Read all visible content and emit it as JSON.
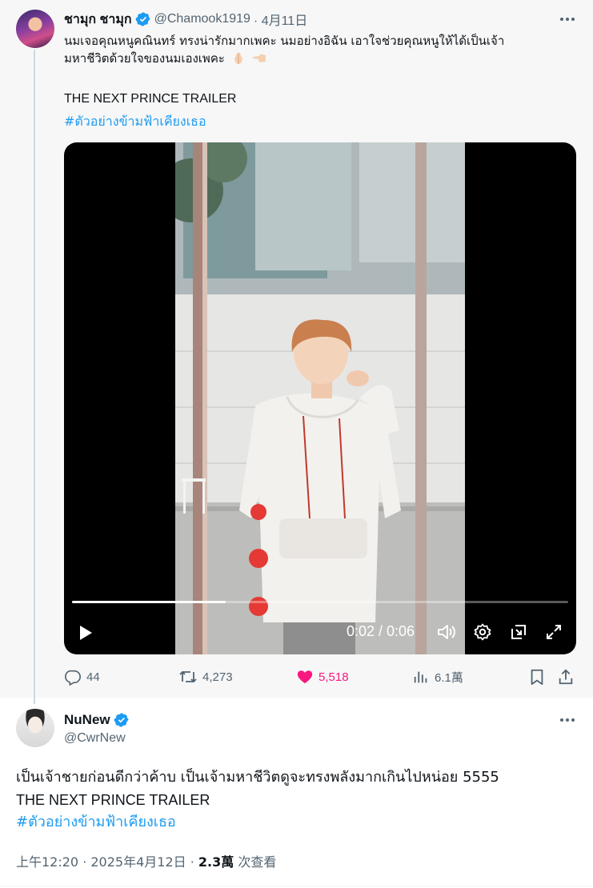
{
  "parent_tweet": {
    "display_name": "ชามุก ชามุก",
    "handle": "@Chamook1919",
    "date": "· 4月11日",
    "text_line1": "นมเจอคุณหนูคณินทร์ ทรงน่ารักมากเพคะ นมอย่างอิฉัน เอาใจช่วยคุณหนูให้ได้เป็นเจ้า",
    "text_line2": "มหาชีวิตด้วยใจของนมเองเพคะ",
    "emoji": [
      "folded-hands-emoji",
      "pointing-left-emoji"
    ],
    "trailer_line": "THE NEXT PRINCE TRAILER",
    "hashtag": "#ตัวอย่างข้ามฟ้าเคียงเธอ",
    "video": {
      "time_display": "0:02 / 0:06",
      "progress_fraction": 0.31,
      "controls": [
        "play-icon",
        "volume-icon",
        "settings-icon",
        "picture-in-picture-icon",
        "fullscreen-icon"
      ]
    },
    "actions": {
      "replies": "44",
      "reposts": "4,273",
      "likes": "5,518",
      "views": "6.1萬"
    }
  },
  "reply_tweet": {
    "display_name": "NuNew",
    "handle": "@CwrNew",
    "text_line1": "เป็นเจ้าชายก่อนดีกว่าค้าบ เป็นเจ้ามหาชีวิตดูจะทรงพลังมากเกินไปหน่อย 5555",
    "text_line2": "THE NEXT PRINCE TRAILER",
    "hashtag": "#ตัวอย่างข้ามฟ้าเคียงเธอ",
    "timestamp": "上午12:20 · 2025年4月12日 · ",
    "view_count": "2.3萬",
    "view_label": " 次查看"
  },
  "colors": {
    "accent_blue": "#1d9bf0",
    "like_pink": "#f91880",
    "secondary_text": "#536471",
    "quoted_background": "#f7f7f7"
  }
}
